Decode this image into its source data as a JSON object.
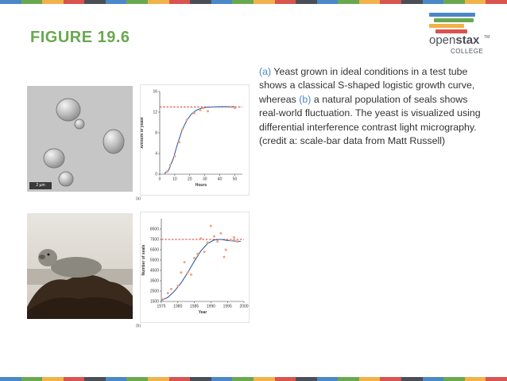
{
  "slide": {
    "title": "FIGURE 19.6",
    "logo": {
      "word_light": "open",
      "word_bold": "stax",
      "tm": "TM",
      "sub": "COLLEGE"
    },
    "caption": {
      "a_label": "(a)",
      "part1": " Yeast grown in ideal conditions in a test tube shows a classical S-shaped logistic growth curve, whereas ",
      "b_label": "(b)",
      "part2": " a natural population of seals shows real-world fluctuation. The yeast is visualized using differential interference contrast light micrography. (credit a: scale-bar data from Matt Russell)"
    },
    "scale_bar_text": "2 µm",
    "panel_a_letter": "(a)",
    "panel_b_letter": "(b)"
  },
  "colors": {
    "title": "#6aa84f",
    "caption_highlight": "#4a88c8",
    "curve": "#2f5fa8",
    "points": "#f2a280",
    "capacity_line": "#e03a2f",
    "stripe": [
      "#4a88c8",
      "#6aa84f",
      "#f0b24a",
      "#d9534f",
      "#4a4f57"
    ]
  },
  "chart_data": [
    {
      "type": "scatter",
      "xlabel": "Hours",
      "ylabel": "Amount of yeast",
      "xlim": [
        0,
        55
      ],
      "ylim": [
        0,
        16
      ],
      "xticks": [
        0,
        10,
        20,
        30,
        40,
        50
      ],
      "yticks": [
        0,
        4,
        8,
        12,
        16
      ],
      "carrying_capacity": 13,
      "points": [
        [
          5,
          0.5
        ],
        [
          7,
          1.8
        ],
        [
          10,
          3.5
        ],
        [
          13,
          6.2
        ],
        [
          15,
          8.6
        ],
        [
          18,
          10.5
        ],
        [
          23,
          11.8
        ],
        [
          27,
          12.4
        ],
        [
          29,
          12.8
        ],
        [
          32,
          12.2
        ],
        [
          47,
          13
        ],
        [
          50,
          12.8
        ]
      ],
      "curve": [
        [
          3,
          0.1
        ],
        [
          6,
          0.8
        ],
        [
          9,
          3
        ],
        [
          12,
          6
        ],
        [
          15,
          8.6
        ],
        [
          18,
          10.4
        ],
        [
          21,
          11.6
        ],
        [
          24,
          12.3
        ],
        [
          27,
          12.7
        ],
        [
          30,
          12.9
        ],
        [
          35,
          13
        ],
        [
          40,
          13.05
        ],
        [
          50,
          13.05
        ]
      ]
    },
    {
      "type": "scatter",
      "xlabel": "Year",
      "ylabel": "Number of seals",
      "xlim": [
        1975,
        2000
      ],
      "ylim": [
        1500,
        9500
      ],
      "xticks": [
        1975,
        1980,
        1985,
        1990,
        1995,
        2000
      ],
      "yticks": [
        1500,
        2500,
        3500,
        4500,
        5500,
        6500,
        7500,
        8500
      ],
      "carrying_capacity": 7500,
      "points": [
        [
          1975.5,
          1700
        ],
        [
          1977,
          2300
        ],
        [
          1978,
          2700
        ],
        [
          1980,
          3000
        ],
        [
          1981,
          4300
        ],
        [
          1982,
          5300
        ],
        [
          1983,
          4300
        ],
        [
          1984,
          4100
        ],
        [
          1985,
          5700
        ],
        [
          1986,
          6100
        ],
        [
          1987,
          7600
        ],
        [
          1988,
          6300
        ],
        [
          1989,
          7200
        ],
        [
          1990,
          8800
        ],
        [
          1991,
          7800
        ],
        [
          1992,
          7300
        ],
        [
          1993,
          8100
        ],
        [
          1994,
          5800
        ],
        [
          1994.5,
          6500
        ],
        [
          1996,
          7400
        ],
        [
          1997,
          7700
        ],
        [
          1998,
          7300
        ]
      ],
      "curve": [
        [
          1975,
          1600
        ],
        [
          1977,
          1900
        ],
        [
          1979,
          2500
        ],
        [
          1981,
          3300
        ],
        [
          1983,
          4300
        ],
        [
          1985,
          5400
        ],
        [
          1987,
          6400
        ],
        [
          1989,
          7100
        ],
        [
          1991,
          7450
        ],
        [
          1993,
          7500
        ],
        [
          1995,
          7400
        ],
        [
          1997,
          7350
        ],
        [
          1999,
          7300
        ]
      ]
    }
  ]
}
